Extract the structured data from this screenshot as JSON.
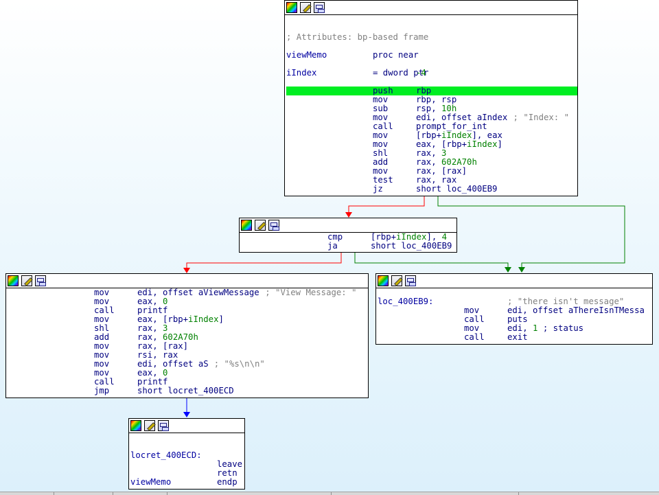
{
  "nodes": {
    "n1": {
      "lines": [
        {
          "text": ""
        },
        {
          "text": ""
        },
        {
          "comment": "; Attributes: bp-based frame"
        },
        {
          "text": ""
        },
        {
          "label": "viewMemo",
          "mnem": "proc near"
        },
        {
          "text": ""
        },
        {
          "label": "iIndex",
          "mnem": "= dword ptr",
          "ops": "-4"
        },
        {
          "text": ""
        },
        {
          "mnem": "push",
          "ops": "rbp"
        },
        {
          "mnem": "mov",
          "ops": "rbp, rsp"
        },
        {
          "mnem": "sub",
          "ops": "rsp, 10h"
        },
        {
          "mnem": "mov",
          "ops": "edi, offset aIndex",
          "cmt": "; \"Index: \""
        },
        {
          "mnem": "call",
          "ops": "prompt_for_int"
        },
        {
          "mnem": "mov",
          "ops": "[rbp+iIndex], eax"
        },
        {
          "mnem": "mov",
          "ops": "eax, [rbp+iIndex]"
        },
        {
          "mnem": "shl",
          "ops": "rax, 3"
        },
        {
          "mnem": "add",
          "ops": "rax, 602A70h"
        },
        {
          "mnem": "mov",
          "ops": "rax, [rax]"
        },
        {
          "mnem": "test",
          "ops": "rax, rax"
        },
        {
          "mnem": "jz",
          "ops": "short loc_400EB9"
        }
      ]
    },
    "n2": {
      "lines": [
        {
          "mnem": "cmp",
          "ops": "[rbp+iIndex], 4"
        },
        {
          "mnem": "ja",
          "ops": "short loc_400EB9"
        }
      ]
    },
    "n3": {
      "lines": [
        {
          "mnem": "mov",
          "ops": "edi, offset aViewMessage",
          "cmt": "; \"View Message: \""
        },
        {
          "mnem": "mov",
          "ops": "eax, 0"
        },
        {
          "mnem": "call",
          "ops": "printf"
        },
        {
          "mnem": "mov",
          "ops": "eax, [rbp+iIndex]"
        },
        {
          "mnem": "shl",
          "ops": "rax, 3"
        },
        {
          "mnem": "add",
          "ops": "rax, 602A70h"
        },
        {
          "mnem": "mov",
          "ops": "rax, [rax]"
        },
        {
          "mnem": "mov",
          "ops": "rsi, rax"
        },
        {
          "mnem": "mov",
          "ops": "edi, offset aS",
          "cmt": "; \"%s\\n\\n\""
        },
        {
          "mnem": "mov",
          "ops": "eax, 0"
        },
        {
          "mnem": "call",
          "ops": "printf"
        },
        {
          "mnem": "jmp",
          "ops": "short locret_400ECD"
        }
      ]
    },
    "n4": {
      "lines": [
        {
          "text": ""
        },
        {
          "label": "loc_400EB9:",
          "cmt": "; \"there isn't message\""
        },
        {
          "mnem": "mov",
          "ops": "edi, offset aThereIsnTMessa"
        },
        {
          "mnem": "call",
          "ops": "puts"
        },
        {
          "mnem": "mov",
          "ops": "edi, 1 ; status"
        },
        {
          "mnem": "call",
          "ops": "exit"
        }
      ]
    },
    "n5": {
      "lines": [
        {
          "text": ""
        },
        {
          "text": ""
        },
        {
          "label": "locret_400ECD:"
        },
        {
          "mnem": "leave"
        },
        {
          "mnem": "retn"
        },
        {
          "label": "viewMemo",
          "mnem": "endp"
        }
      ]
    }
  },
  "colors": {
    "highlight": "#00ee22",
    "edge_true": "#008000",
    "edge_false": "#ff0000",
    "edge_uncond": "#0000ff"
  }
}
